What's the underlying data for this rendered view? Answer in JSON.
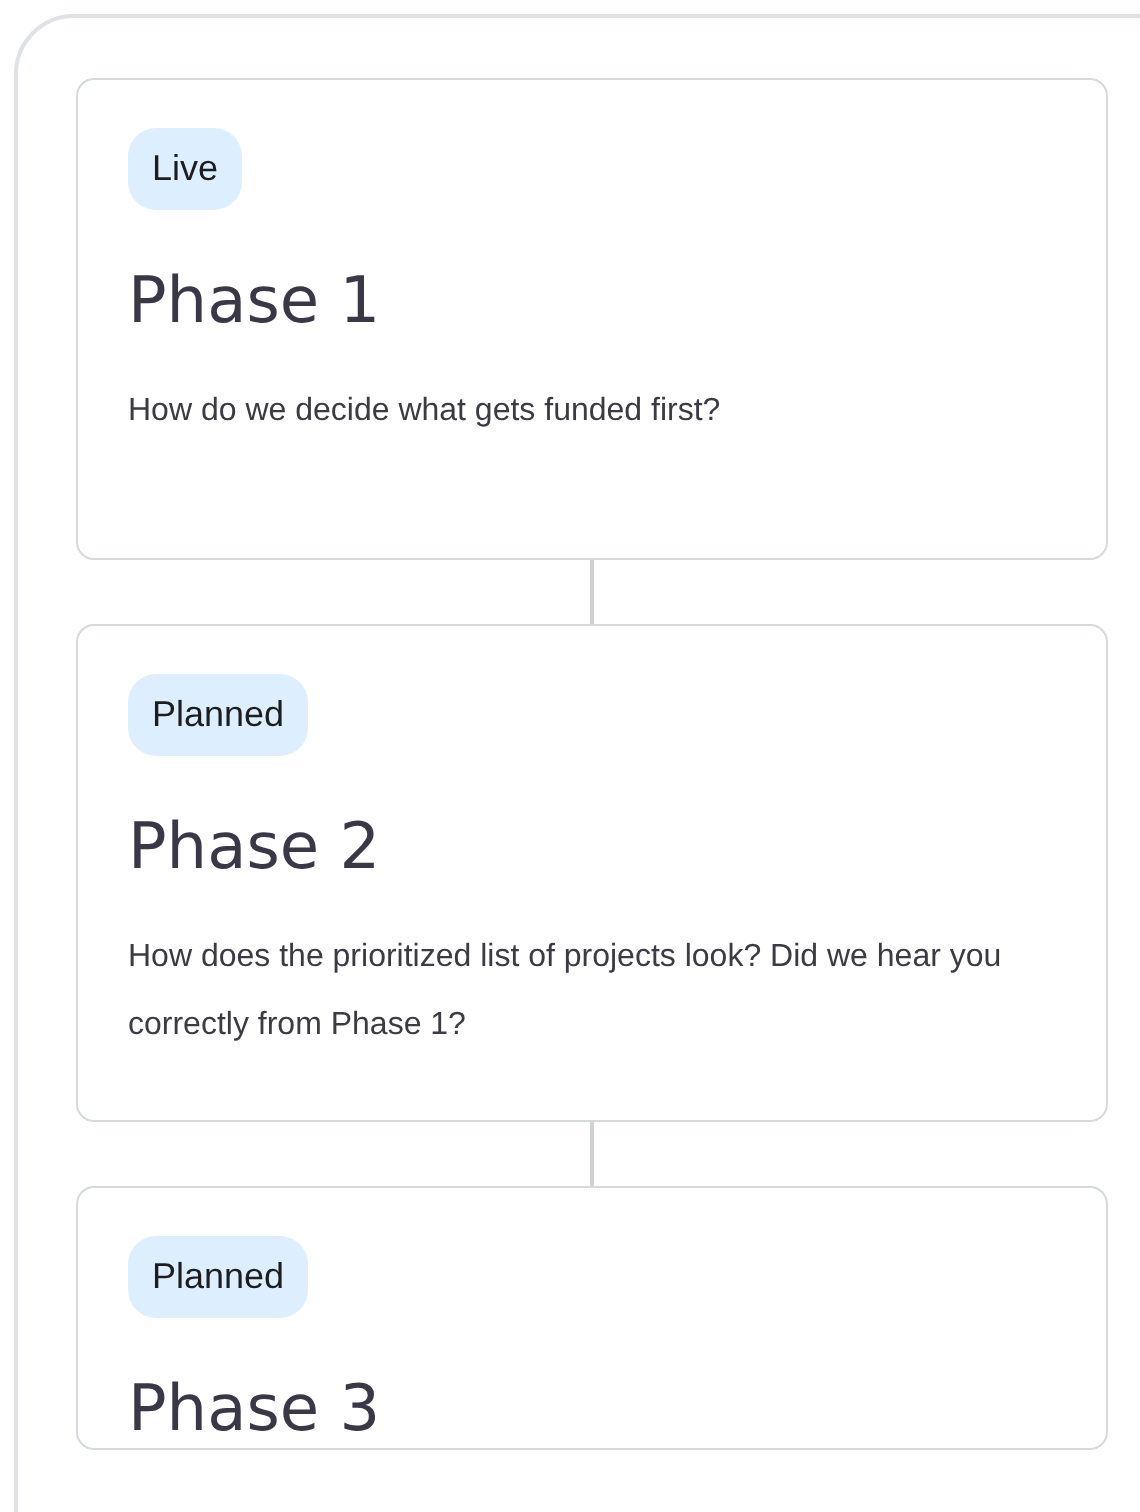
{
  "phases": [
    {
      "status": "Live",
      "title": "Phase 1",
      "description": "How do we decide what gets funded first?"
    },
    {
      "status": "Planned",
      "title": "Phase 2",
      "description": "How does the prioritized list of projects look? Did we hear you correctly from Phase 1?"
    },
    {
      "status": "Planned",
      "title": "Phase 3"
    }
  ]
}
